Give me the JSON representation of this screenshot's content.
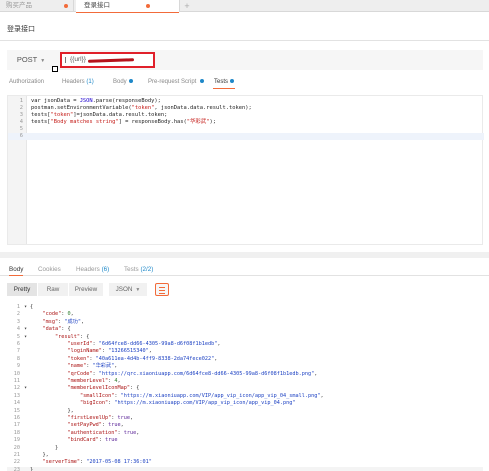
{
  "tabs": [
    {
      "label": "购买产品",
      "dot": true,
      "active": false
    },
    {
      "label": "登录接口",
      "dot": true,
      "active": true
    }
  ],
  "new_tab_label": "+",
  "request_name": "登录接口",
  "method": "POST",
  "url": "{{url}}",
  "request_tabs": {
    "authorization": "Authorization",
    "headers": "Headers",
    "headers_count": "(1)",
    "body": "Body",
    "prerequest": "Pre-request Script",
    "tests": "Tests"
  },
  "tests_script": [
    [
      {
        "t": "var jsonData = ",
        "c": "plain"
      },
      {
        "t": "JSON",
        "c": "obj"
      },
      {
        "t": ".parse(responseBody);",
        "c": "plain"
      }
    ],
    [
      {
        "t": "postman.setEnvironmentVariable(",
        "c": "plain"
      },
      {
        "t": "\"token\"",
        "c": "str"
      },
      {
        "t": ", jsonData.data.result.token);",
        "c": "plain"
      }
    ],
    [
      {
        "t": "tests[",
        "c": "plain"
      },
      {
        "t": "\"token\"",
        "c": "str"
      },
      {
        "t": "]=jsonData.data.result.token;",
        "c": "plain"
      }
    ],
    [
      {
        "t": "tests[",
        "c": "plain"
      },
      {
        "t": "\"Body matches string\"",
        "c": "str"
      },
      {
        "t": "] = responseBody.has(",
        "c": "plain"
      },
      {
        "t": "\"华彩武\"",
        "c": "str"
      },
      {
        "t": ");",
        "c": "plain"
      }
    ]
  ],
  "tests_line_count": 6,
  "response_tabs": {
    "body": "Body",
    "cookies": "Cookies",
    "headers": "Headers",
    "headers_count": "(6)",
    "tests": "Tests",
    "tests_count": "(2/2)"
  },
  "response_toolbar": {
    "pretty": "Pretty",
    "raw": "Raw",
    "preview": "Preview",
    "format": "JSON"
  },
  "response_body": [
    {
      "fold": "▾",
      "tokens": [
        {
          "t": "{",
          "c": "p"
        }
      ]
    },
    {
      "fold": "",
      "tokens": [
        {
          "t": "    ",
          "c": "p"
        },
        {
          "t": "\"code\"",
          "c": "k"
        },
        {
          "t": ": ",
          "c": "p"
        },
        {
          "t": "0",
          "c": "n"
        },
        {
          "t": ",",
          "c": "p"
        }
      ]
    },
    {
      "fold": "",
      "tokens": [
        {
          "t": "    ",
          "c": "p"
        },
        {
          "t": "\"msg\"",
          "c": "k"
        },
        {
          "t": ": ",
          "c": "p"
        },
        {
          "t": "\"成功\"",
          "c": "v"
        },
        {
          "t": ",",
          "c": "p"
        }
      ]
    },
    {
      "fold": "▾",
      "tokens": [
        {
          "t": "    ",
          "c": "p"
        },
        {
          "t": "\"data\"",
          "c": "k"
        },
        {
          "t": ": {",
          "c": "p"
        }
      ]
    },
    {
      "fold": "▾",
      "tokens": [
        {
          "t": "        ",
          "c": "p"
        },
        {
          "t": "\"result\"",
          "c": "k"
        },
        {
          "t": ": {",
          "c": "p"
        }
      ]
    },
    {
      "fold": "",
      "tokens": [
        {
          "t": "            ",
          "c": "p"
        },
        {
          "t": "\"userId\"",
          "c": "k"
        },
        {
          "t": ": ",
          "c": "p"
        },
        {
          "t": "\"6d64fce8-dd66-4305-99a8-d6f08f1b1edb\"",
          "c": "v"
        },
        {
          "t": ",",
          "c": "p"
        }
      ]
    },
    {
      "fold": "",
      "tokens": [
        {
          "t": "            ",
          "c": "p"
        },
        {
          "t": "\"loginName\"",
          "c": "k"
        },
        {
          "t": ": ",
          "c": "p"
        },
        {
          "t": "\"13266515340\"",
          "c": "v"
        },
        {
          "t": ",",
          "c": "p"
        }
      ]
    },
    {
      "fold": "",
      "tokens": [
        {
          "t": "            ",
          "c": "p"
        },
        {
          "t": "\"token\"",
          "c": "k"
        },
        {
          "t": ": ",
          "c": "p"
        },
        {
          "t": "\"40a611ea-4d4b-4ff9-8338-2da74fece022\"",
          "c": "v"
        },
        {
          "t": ",",
          "c": "p"
        }
      ]
    },
    {
      "fold": "",
      "tokens": [
        {
          "t": "            ",
          "c": "p"
        },
        {
          "t": "\"name\"",
          "c": "k"
        },
        {
          "t": ": ",
          "c": "p"
        },
        {
          "t": "\"华彩武\"",
          "c": "v"
        },
        {
          "t": ",",
          "c": "p"
        }
      ]
    },
    {
      "fold": "",
      "tokens": [
        {
          "t": "            ",
          "c": "p"
        },
        {
          "t": "\"qrCode\"",
          "c": "k"
        },
        {
          "t": ": ",
          "c": "p"
        },
        {
          "t": "\"https://qrc.xiaoniuapp.com/6d64fce8-dd66-4305-99a8-d6f08f1b1edb.png\"",
          "c": "v"
        },
        {
          "t": ",",
          "c": "p"
        }
      ]
    },
    {
      "fold": "",
      "tokens": [
        {
          "t": "            ",
          "c": "p"
        },
        {
          "t": "\"memberLevel\"",
          "c": "k"
        },
        {
          "t": ": ",
          "c": "p"
        },
        {
          "t": "4",
          "c": "n"
        },
        {
          "t": ",",
          "c": "p"
        }
      ]
    },
    {
      "fold": "▾",
      "tokens": [
        {
          "t": "            ",
          "c": "p"
        },
        {
          "t": "\"memberLevelIconMap\"",
          "c": "k"
        },
        {
          "t": ": {",
          "c": "p"
        }
      ]
    },
    {
      "fold": "",
      "tokens": [
        {
          "t": "                ",
          "c": "p"
        },
        {
          "t": "\"smallIcon\"",
          "c": "k"
        },
        {
          "t": ": ",
          "c": "p"
        },
        {
          "t": "\"https://m.xiaoniuapp.com/VIP/app_vip_icon/app_vip_04_small.png\"",
          "c": "v"
        },
        {
          "t": ",",
          "c": "p"
        }
      ]
    },
    {
      "fold": "",
      "tokens": [
        {
          "t": "                ",
          "c": "p"
        },
        {
          "t": "\"bigIcon\"",
          "c": "k"
        },
        {
          "t": ": ",
          "c": "p"
        },
        {
          "t": "\"https://m.xiaoniuapp.com/VIP/app_vip_icon/app_vip_04.png\"",
          "c": "v"
        }
      ]
    },
    {
      "fold": "",
      "tokens": [
        {
          "t": "            },",
          "c": "p"
        }
      ]
    },
    {
      "fold": "",
      "tokens": [
        {
          "t": "            ",
          "c": "p"
        },
        {
          "t": "\"firstLevelUp\"",
          "c": "k"
        },
        {
          "t": ": ",
          "c": "p"
        },
        {
          "t": "true",
          "c": "bl"
        },
        {
          "t": ",",
          "c": "p"
        }
      ]
    },
    {
      "fold": "",
      "tokens": [
        {
          "t": "            ",
          "c": "p"
        },
        {
          "t": "\"setPayPwd\"",
          "c": "k"
        },
        {
          "t": ": ",
          "c": "p"
        },
        {
          "t": "true",
          "c": "bl"
        },
        {
          "t": ",",
          "c": "p"
        }
      ]
    },
    {
      "fold": "",
      "tokens": [
        {
          "t": "            ",
          "c": "p"
        },
        {
          "t": "\"authentication\"",
          "c": "k"
        },
        {
          "t": ": ",
          "c": "p"
        },
        {
          "t": "true",
          "c": "bl"
        },
        {
          "t": ",",
          "c": "p"
        }
      ]
    },
    {
      "fold": "",
      "tokens": [
        {
          "t": "            ",
          "c": "p"
        },
        {
          "t": "\"bindCard\"",
          "c": "k"
        },
        {
          "t": ": ",
          "c": "p"
        },
        {
          "t": "true",
          "c": "bl"
        }
      ]
    },
    {
      "fold": "",
      "tokens": [
        {
          "t": "        }",
          "c": "p"
        }
      ]
    },
    {
      "fold": "",
      "tokens": [
        {
          "t": "    },",
          "c": "p"
        }
      ]
    },
    {
      "fold": "",
      "tokens": [
        {
          "t": "    ",
          "c": "p"
        },
        {
          "t": "\"serverTime\"",
          "c": "k"
        },
        {
          "t": ": ",
          "c": "p"
        },
        {
          "t": "\"2017-05-08 17:36:01\"",
          "c": "v"
        }
      ]
    },
    {
      "fold": "",
      "tokens": [
        {
          "t": "}",
          "c": "p"
        }
      ]
    }
  ],
  "colors": {
    "accent": "#f26b3a",
    "highlight_box": "#e0202a",
    "link_blue": "#1e88c8"
  }
}
